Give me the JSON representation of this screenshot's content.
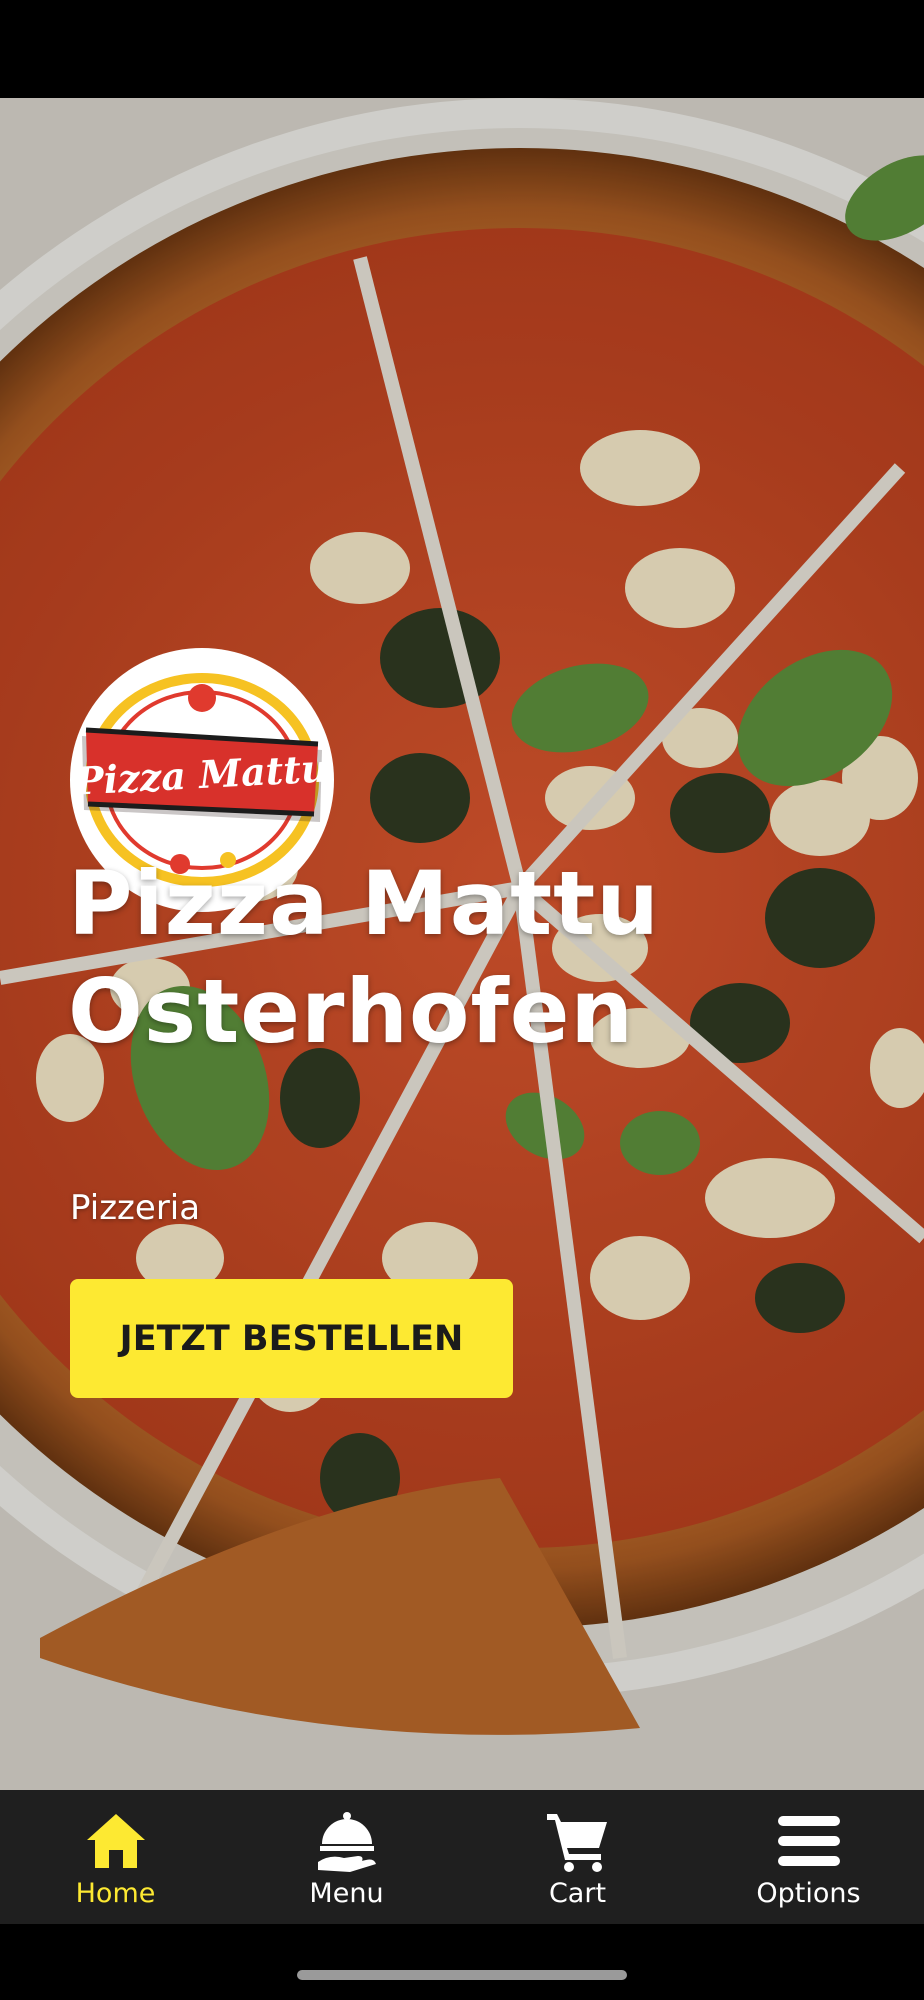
{
  "app": {
    "logo_text": "Pizza Mattu",
    "title_line1": "Pizza Mattu",
    "title_line2": "Osterhofen",
    "subtitle": "Pizzeria",
    "cta_label": "JETZT BESTELLEN",
    "accent_color": "#fde932"
  },
  "nav": {
    "items": [
      {
        "label": "Home",
        "icon": "home-icon",
        "active": true
      },
      {
        "label": "Menu",
        "icon": "food-cloche-icon",
        "active": false
      },
      {
        "label": "Cart",
        "icon": "cart-icon",
        "active": false
      },
      {
        "label": "Options",
        "icon": "hamburger-menu-icon",
        "active": false
      }
    ]
  }
}
